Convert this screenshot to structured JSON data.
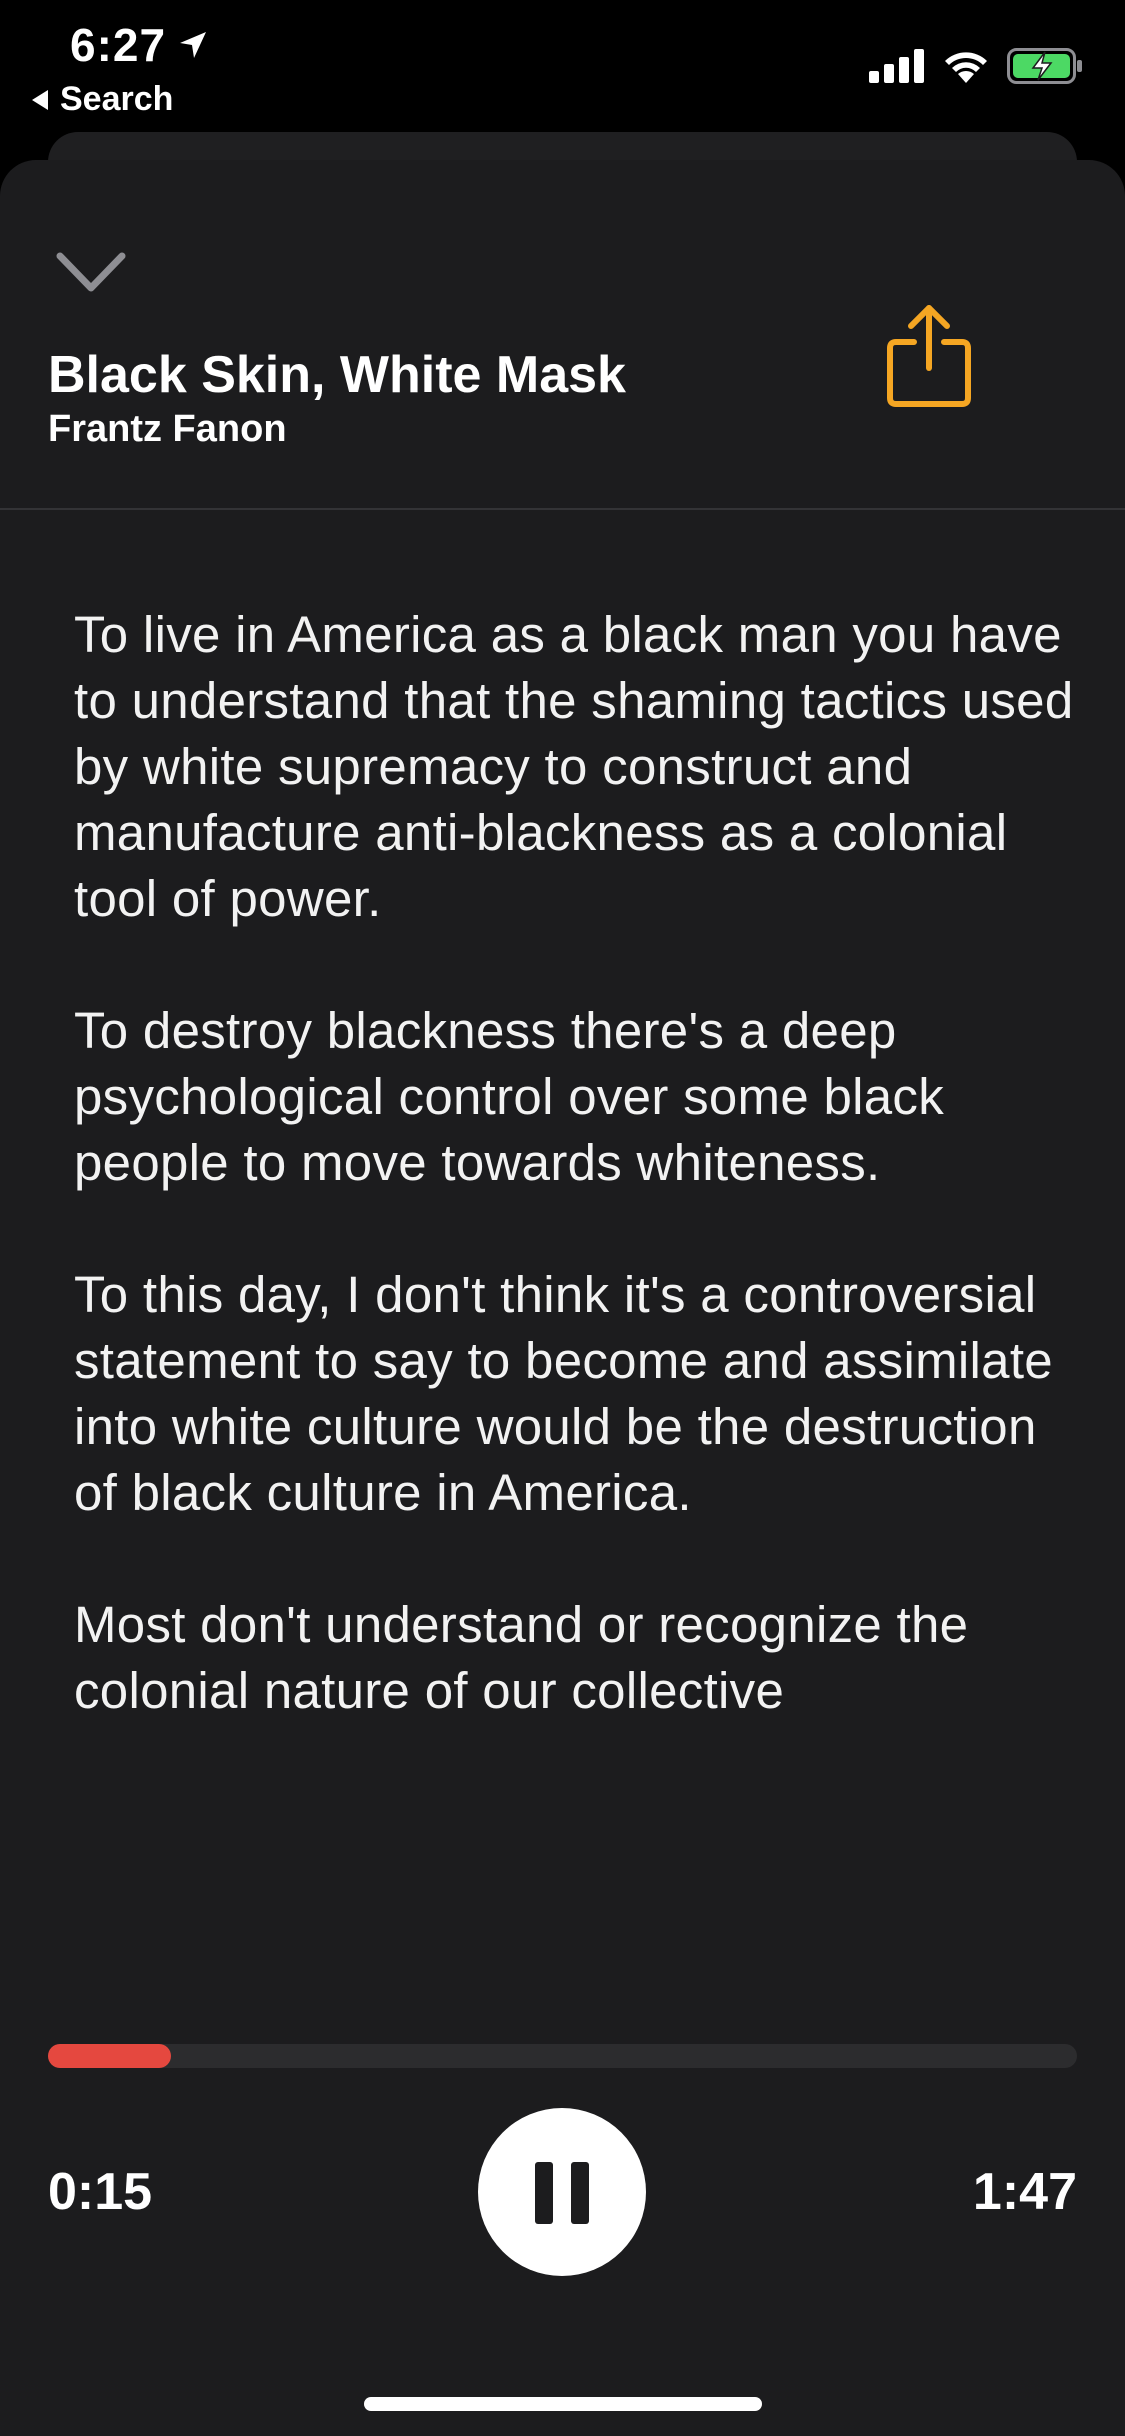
{
  "status_bar": {
    "time": "6:27",
    "back_label": "Search"
  },
  "header": {
    "title": "Black Skin, White Mask",
    "author": "Frantz Fanon"
  },
  "content": {
    "paragraphs": [
      "To live in America as a black man you have to understand that the shaming tactics used by white supremacy to construct and manufacture anti-blackness as a colonial tool of power.",
      "To destroy blackness there's a deep psychological control over some black people to move towards whiteness.",
      "To this day, I don't think it's a controversial statement to say to become and assimilate into white culture would be the destruction of black culture in America.",
      "Most don't understand or recognize the colonial nature of our collective"
    ]
  },
  "player": {
    "elapsed": "0:15",
    "total": "1:47",
    "progress_fraction": 0.12,
    "state": "playing"
  },
  "colors": {
    "accent": "#F5A623",
    "progress": "#E5483F",
    "background": "#1C1C1E"
  },
  "icons": {
    "collapse": "chevron-down-icon",
    "share": "share-icon",
    "pause": "pause-icon"
  }
}
